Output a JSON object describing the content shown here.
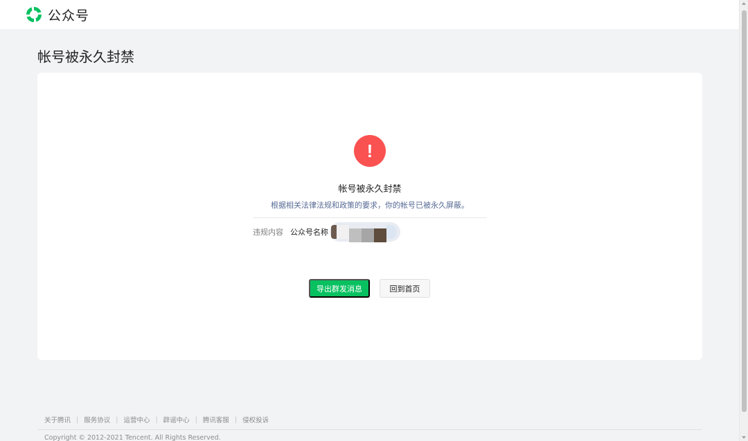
{
  "header": {
    "app_name": "公众号",
    "brand_color": "#07c160"
  },
  "page": {
    "title": "帐号被永久封禁"
  },
  "status": {
    "icon": "exclamation-icon",
    "icon_glyph": "!",
    "icon_color": "#fa5151",
    "title": "帐号被永久封禁",
    "description": "根据相关法律法规和政策的要求，你的帐号已被永久屏蔽。"
  },
  "violation": {
    "label": "违规内容",
    "value": "公众号名称"
  },
  "actions": {
    "export_label": "导出群发消息",
    "home_label": "回到首页"
  },
  "footer": {
    "links": [
      "关于腾讯",
      "服务协议",
      "运营中心",
      "辟谣中心",
      "腾讯客服",
      "侵权投诉"
    ],
    "separator": "|",
    "copyright": "Copyright © 2012-2021 Tencent. All Rights Reserved."
  }
}
